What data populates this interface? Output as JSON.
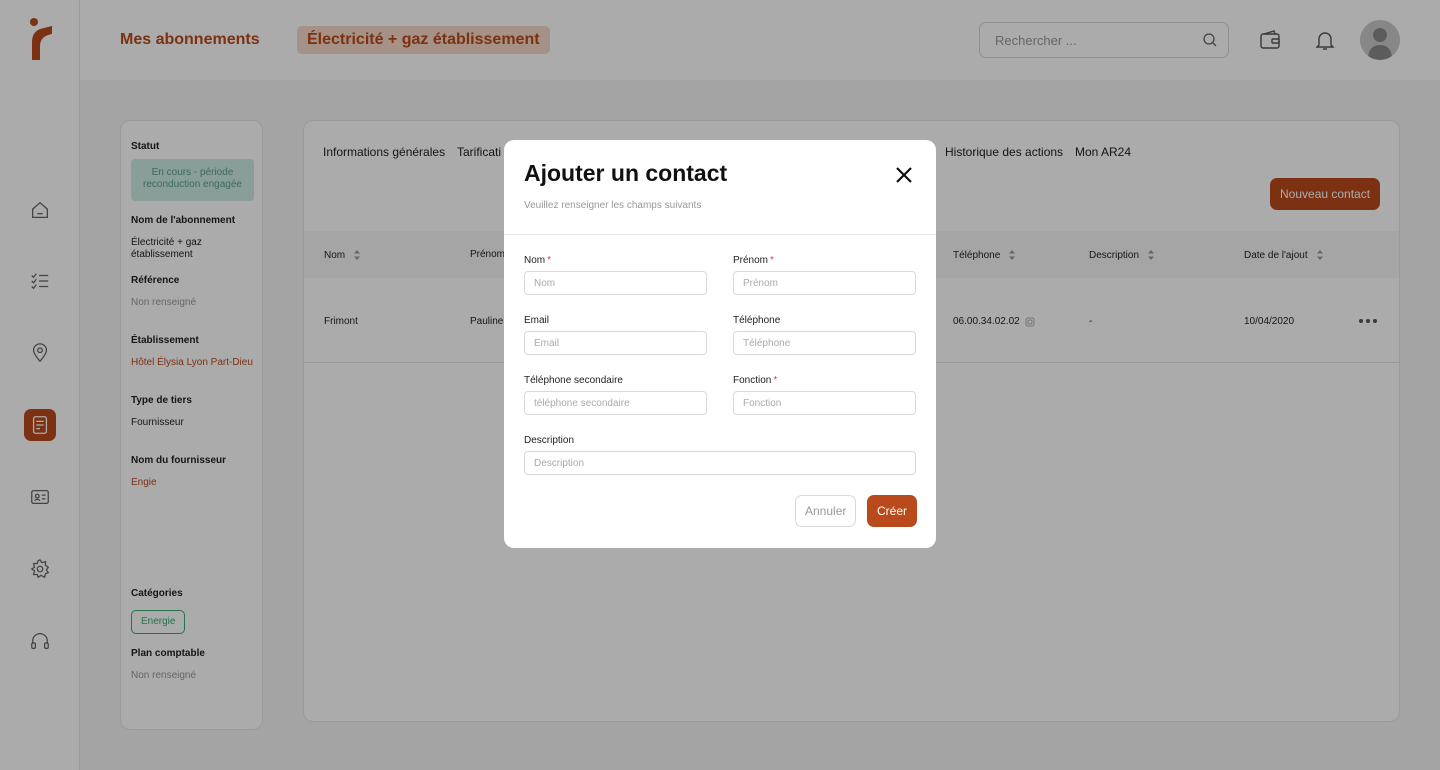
{
  "colors": {
    "accent": "#b84a1c",
    "accent_soft": "#f7d9c7",
    "status_bg": "#cdebe4",
    "category": "#3aaa72"
  },
  "header": {
    "title": "Mes abonnements",
    "tag": "Électricité + gaz établissement",
    "search_placeholder": "Rechercher ...",
    "icons": [
      "search-icon",
      "wallet-icon",
      "bell-icon",
      "avatar"
    ]
  },
  "sidebar": {
    "items": [
      {
        "icon": "home-icon",
        "active": false
      },
      {
        "icon": "checklist-icon",
        "active": false
      },
      {
        "icon": "location-pin-icon",
        "active": false
      },
      {
        "icon": "document-icon",
        "active": true
      },
      {
        "icon": "id-card-icon",
        "active": false
      },
      {
        "icon": "gear-icon",
        "active": false
      },
      {
        "icon": "headset-icon",
        "active": false
      }
    ]
  },
  "info": {
    "status_label": "Statut",
    "status_value": "En cours - période reconduction engagée",
    "subscription_label": "Nom de l'abonnement",
    "subscription_value": "Électricité + gaz établissement",
    "reference_label": "Référence",
    "reference_value": "Non renseigné",
    "establishment_label": "Établissement",
    "establishment_value": "Hôtel Élysia Lyon Part-Dieu",
    "tier_type_label": "Type de tiers",
    "tier_type_value": "Fournisseur",
    "supplier_label": "Nom du fournisseur",
    "supplier_value": "Engie",
    "categories_label": "Catégories",
    "category_value": "Energie",
    "account_plan_label": "Plan comptable",
    "account_plan_value": "Non renseigné"
  },
  "tabs": [
    "Informations générales",
    "Tarificati",
    "Historique des actions",
    "Mon AR24"
  ],
  "new_contact_label": "Nouveau contact",
  "table": {
    "columns": [
      "Nom",
      "Prénom",
      "Téléphone",
      "Description",
      "Date de l'ajout"
    ],
    "rows": [
      {
        "nom": "Frimont",
        "prenom": "Pauline",
        "telephone": "06.00.34.02.02",
        "description": "-",
        "date": "10/04/2020"
      }
    ]
  },
  "modal": {
    "title": "Ajouter un contact",
    "subtitle": "Veuillez renseigner les champs suivants",
    "fields": {
      "nom": {
        "label": "Nom",
        "placeholder": "Nom",
        "required": "*"
      },
      "prenom": {
        "label": "Prénom",
        "placeholder": "Prénom",
        "required": "*"
      },
      "email": {
        "label": "Email",
        "placeholder": "Email"
      },
      "telephone": {
        "label": "Téléphone",
        "placeholder": "Téléphone"
      },
      "telephone2": {
        "label": "Téléphone secondaire",
        "placeholder": "téléphone secondaire"
      },
      "fonction": {
        "label": "Fonction",
        "placeholder": "Fonction",
        "required": "*"
      },
      "description": {
        "label": "Description",
        "placeholder": "Description"
      }
    },
    "cancel_label": "Annuler",
    "create_label": "Créer"
  }
}
